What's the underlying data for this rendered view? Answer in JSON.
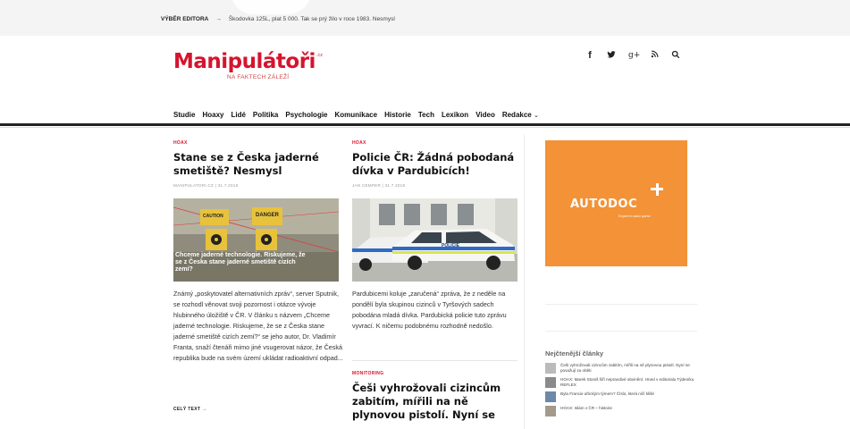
{
  "topbar": {
    "label": "VÝBĚR EDITORA",
    "arrow": "→",
    "headline": "Škodovka 125L, plat 5 000. Tak se prý žilo v roce 1983. Nesmysl"
  },
  "logo": {
    "word": "Manipulátoři",
    "cz": ".cz",
    "tagline": "NA FAKTECH ZÁLEŽÍ"
  },
  "social": {
    "facebook": "f",
    "twitter": "🐦",
    "gplus": "g+",
    "rss": "⟟",
    "search": "⚲"
  },
  "nav": {
    "items": [
      "Studie",
      "Hoaxy",
      "Lidé",
      "Politika",
      "Psychologie",
      "Komunikace",
      "Historie",
      "Tech",
      "Lexikon",
      "Video",
      "Redakce"
    ],
    "chevron": "⌄"
  },
  "articles": [
    {
      "category": "HOAX",
      "title": "Stane se z Česka jaderné smetiště? Nesmysl",
      "meta": "MANIPULATORI.CZ | 31.7.2018",
      "image_caption": "Chceme jaderné technologie. Riskujeme, že se z Česka stane jaderné smetiště cizích zemí?",
      "image_sign1": "CAUTION",
      "image_sign2": "DANGER",
      "excerpt": "Známý „poskytovatel alternativních zpráv“, server Sputnik, se rozhodl věnovat svoji pozornost i otázce vývoje hlubinného úložiště v ČR. V článku s názvem „Chceme jaderné technologie. Riskujeme, že se z Česka stane jaderné smetiště cizích zemí?“ se jeho autor, Dr. Vladimír Franta, snaží čtenáři mimo jiné vsugerovat názor, že Česká republika bude na svém území ukládat radioaktivní odpad...",
      "more": "CELÝ TEXT →"
    },
    {
      "category": "HOAX",
      "title": "Policie ČR: Žádná pobodaná dívka v Pardubicích!",
      "meta": "JAN CEMPER | 31.7.2018",
      "car_label": "POLICIE",
      "excerpt": "Pardubicemi koluje „zaručená“ zpráva, že z neděle na pondělí byla skupinou cizinců v Tyršových sadech pobodána mladá dívka. Pardubická policie tuto zprávu vyvrací. K ničemu podobnému rozhodně nedošlo."
    },
    {
      "category": "MONITORING",
      "title": "Češi vyhrožovali cizincům zabitím, mířili na ně plynovou pistolí. Nyní se"
    }
  ],
  "ad": {
    "brand": "AUTODOC",
    "slogan": "Expert in auto parts!",
    "color": "#f39237"
  },
  "sidebar": {
    "heading": "Nejčtenější články",
    "items": [
      "Češi vyhrožovali cizincům zabitím, mířili na ně plynovou pistolí. Nyní se považují za oběti",
      "HOAX: Marek Stoniš šíři nepravdivé obvinění. Hned v editorialu Týdeníku REFLEX",
      "Byla Francie africkým týmem? Číslo, která ničí klišé",
      "HOAX: Islám v ČR – historie"
    ]
  },
  "colors": {
    "brand": "#d6142d",
    "nav_rule": "#222222"
  }
}
